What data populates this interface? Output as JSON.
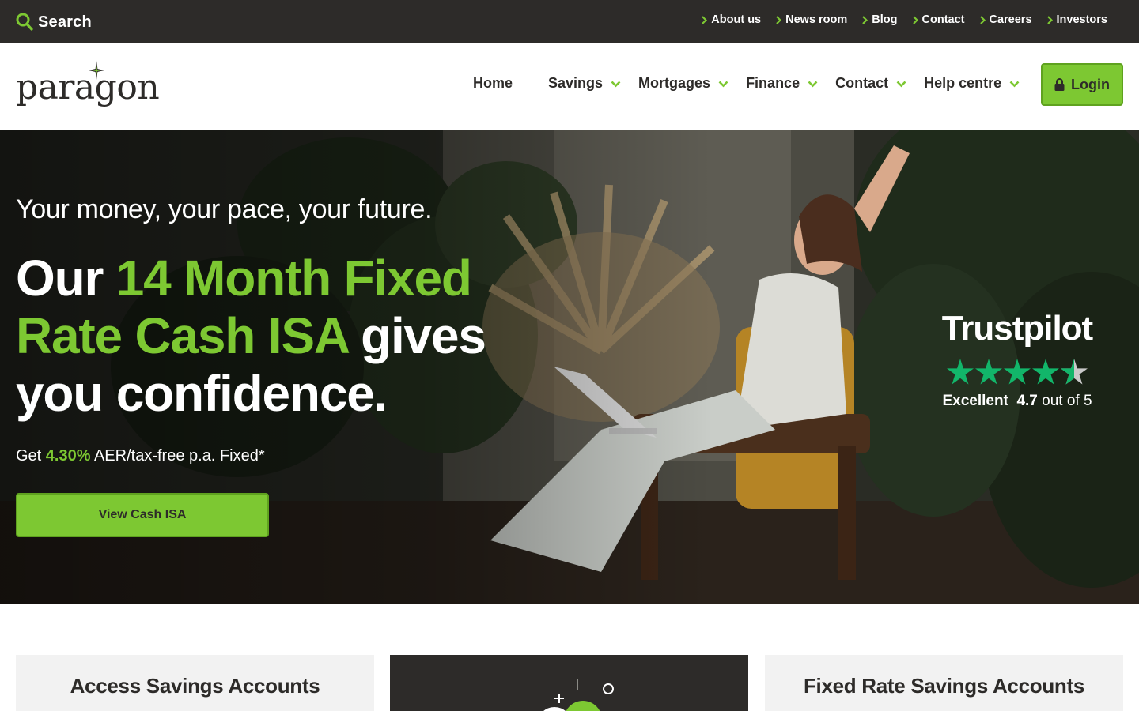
{
  "topbar": {
    "search_label": "Search",
    "links": [
      {
        "label": "About us"
      },
      {
        "label": "News room"
      },
      {
        "label": "Blog"
      },
      {
        "label": "Contact"
      },
      {
        "label": "Careers"
      },
      {
        "label": "Investors"
      }
    ]
  },
  "header": {
    "logo_text": "paragon",
    "nav": [
      {
        "label": "Home"
      },
      {
        "label": "Savings"
      },
      {
        "label": "Mortgages"
      },
      {
        "label": "Finance"
      },
      {
        "label": "Contact"
      },
      {
        "label": "Help centre"
      }
    ],
    "login_label": "Login"
  },
  "hero": {
    "kicker": "Your money, your pace, your future.",
    "title_part1": "Our ",
    "title_highlight": "14 Month Fixed Rate Cash ISA",
    "title_part2": " gives you confidence.",
    "rate_prefix": "Get ",
    "rate_value": "4.30%",
    "rate_suffix": " AER/tax-free p.a. Fixed*",
    "cta_label": "View Cash ISA"
  },
  "trustpilot": {
    "brand": "Trustpilot",
    "rating_word": "Excellent",
    "score": "4.7",
    "out_of": "out of 5",
    "stars_rating": 4.7
  },
  "cards": [
    {
      "title": "Access Savings Accounts"
    },
    {
      "title": ""
    },
    {
      "title": "Fixed Rate Savings Accounts"
    }
  ],
  "colors": {
    "brand_green": "#7dc832",
    "dark": "#2d2b29",
    "card_grey": "#f2f2f2"
  }
}
